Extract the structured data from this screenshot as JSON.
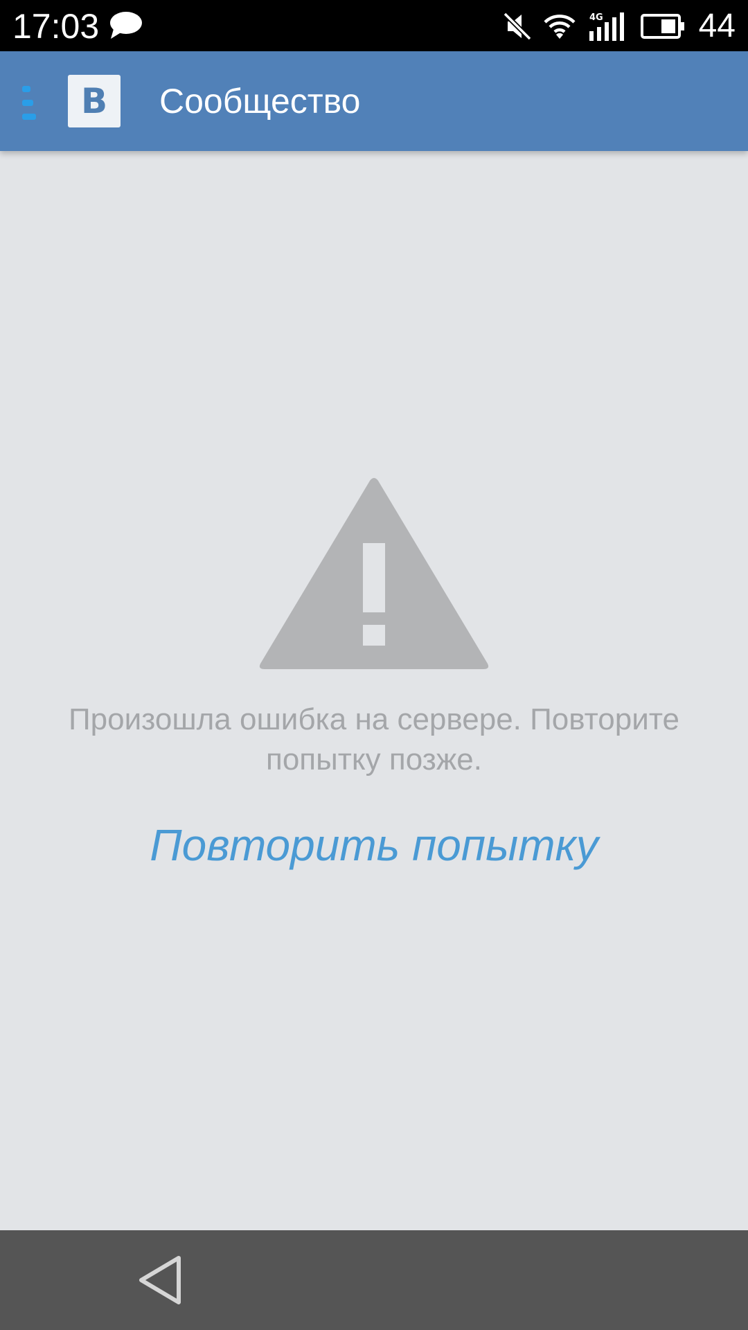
{
  "status_bar": {
    "time": "17:03",
    "battery_percent": "44",
    "icons": [
      "message-icon",
      "mute-icon",
      "wifi-icon",
      "signal-4g-icon",
      "battery-icon"
    ]
  },
  "app_bar": {
    "logo_letter": "B",
    "title": "Сообщество",
    "color": "#5181b8"
  },
  "error": {
    "message": "Произошла ошибка на сервере. Повторите попытку позже.",
    "retry_label": "Повторить попытку",
    "link_color": "#4a9ad4",
    "icon": "warning-icon"
  },
  "nav_bar": {
    "icons": [
      "back-icon"
    ]
  }
}
